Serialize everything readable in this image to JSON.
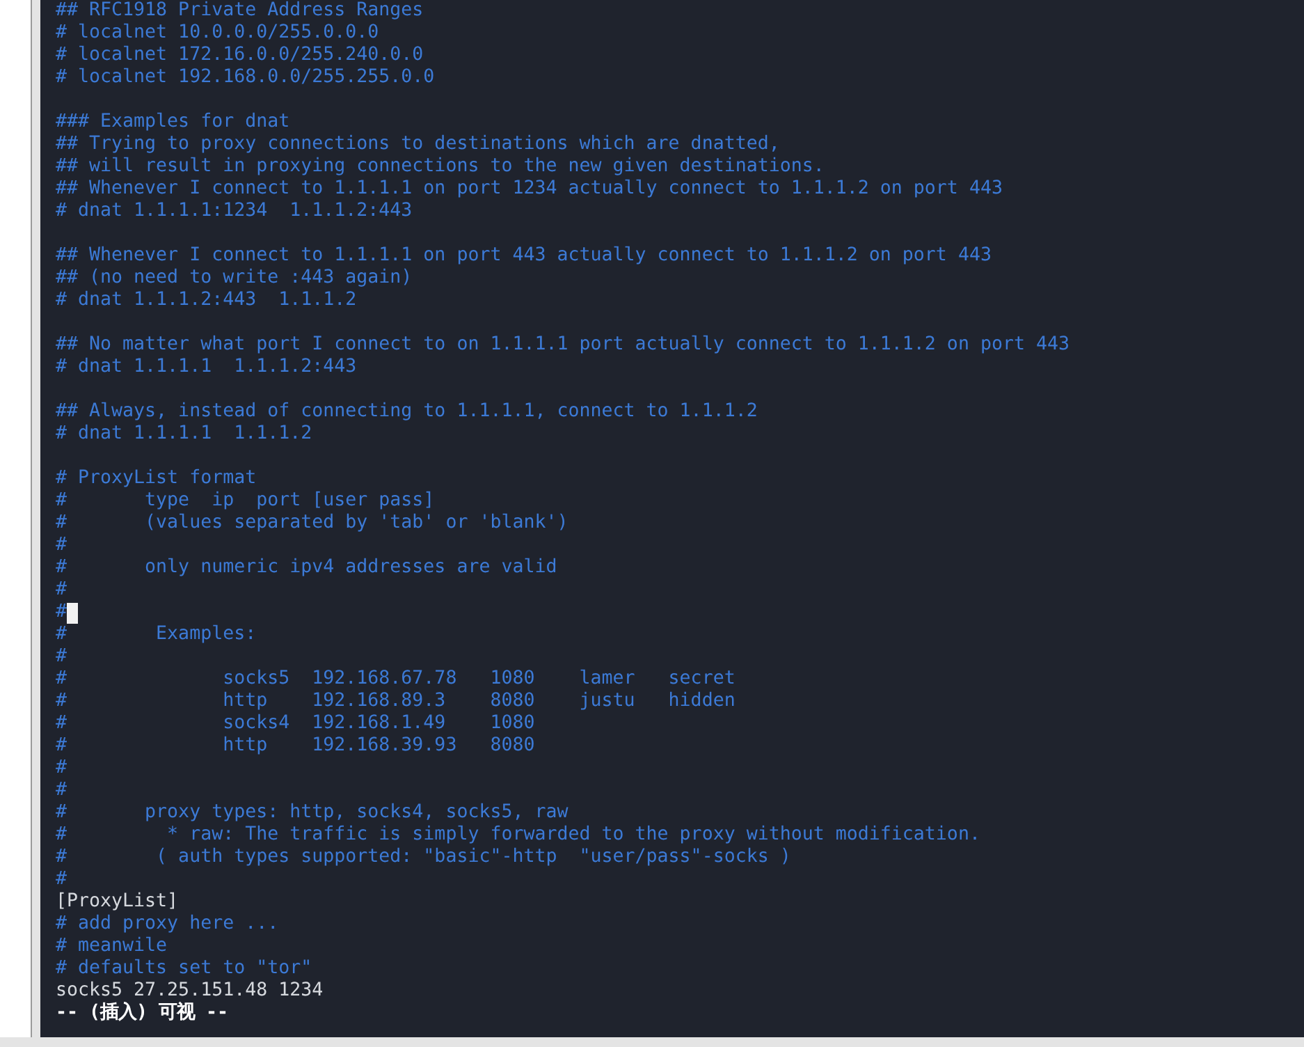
{
  "editor": {
    "lines": [
      {
        "kind": "comment",
        "text": "## RFC1918 Private Address Ranges",
        "cursor": false
      },
      {
        "kind": "comment",
        "text": "# localnet 10.0.0.0/255.0.0.0",
        "cursor": false
      },
      {
        "kind": "comment",
        "text": "# localnet 172.16.0.0/255.240.0.0",
        "cursor": false
      },
      {
        "kind": "comment",
        "text": "# localnet 192.168.0.0/255.255.0.0",
        "cursor": false
      },
      {
        "kind": "blank",
        "cursor": false
      },
      {
        "kind": "comment",
        "text": "### Examples for dnat",
        "cursor": false
      },
      {
        "kind": "comment",
        "text": "## Trying to proxy connections to destinations which are dnatted,",
        "cursor": false
      },
      {
        "kind": "comment",
        "text": "## will result in proxying connections to the new given destinations.",
        "cursor": false
      },
      {
        "kind": "comment",
        "text": "## Whenever I connect to 1.1.1.1 on port 1234 actually connect to 1.1.1.2 on port 443",
        "cursor": false
      },
      {
        "kind": "comment",
        "text": "# dnat 1.1.1.1:1234  1.1.1.2:443",
        "cursor": false
      },
      {
        "kind": "blank",
        "cursor": false
      },
      {
        "kind": "comment",
        "text": "## Whenever I connect to 1.1.1.1 on port 443 actually connect to 1.1.1.2 on port 443",
        "cursor": false
      },
      {
        "kind": "comment",
        "text": "## (no need to write :443 again)",
        "cursor": false
      },
      {
        "kind": "comment",
        "text": "# dnat 1.1.1.2:443  1.1.1.2",
        "cursor": false
      },
      {
        "kind": "blank",
        "cursor": false
      },
      {
        "kind": "comment",
        "text": "## No matter what port I connect to on 1.1.1.1 port actually connect to 1.1.1.2 on port 443",
        "cursor": false
      },
      {
        "kind": "comment",
        "text": "# dnat 1.1.1.1  1.1.1.2:443",
        "cursor": false
      },
      {
        "kind": "blank",
        "cursor": false
      },
      {
        "kind": "comment",
        "text": "## Always, instead of connecting to 1.1.1.1, connect to 1.1.1.2",
        "cursor": false
      },
      {
        "kind": "comment",
        "text": "# dnat 1.1.1.1  1.1.1.2",
        "cursor": false
      },
      {
        "kind": "blank",
        "cursor": false
      },
      {
        "kind": "comment",
        "text": "# ProxyList format",
        "cursor": false
      },
      {
        "kind": "comment",
        "text": "#       type  ip  port [user pass]",
        "cursor": false
      },
      {
        "kind": "comment",
        "text": "#       (values separated by 'tab' or 'blank')",
        "cursor": false
      },
      {
        "kind": "comment",
        "text": "#",
        "cursor": false
      },
      {
        "kind": "comment",
        "text": "#       only numeric ipv4 addresses are valid",
        "cursor": false
      },
      {
        "kind": "comment",
        "text": "#",
        "cursor": false
      },
      {
        "kind": "comment",
        "text": "#",
        "cursor": true
      },
      {
        "kind": "comment",
        "text": "#        Examples:",
        "cursor": false
      },
      {
        "kind": "comment",
        "text": "#",
        "cursor": false
      },
      {
        "kind": "comment",
        "text": "#              socks5  192.168.67.78   1080    lamer   secret",
        "cursor": false
      },
      {
        "kind": "comment",
        "text": "#              http    192.168.89.3    8080    justu   hidden",
        "cursor": false
      },
      {
        "kind": "comment",
        "text": "#              socks4  192.168.1.49    1080",
        "cursor": false
      },
      {
        "kind": "comment",
        "text": "#              http    192.168.39.93   8080",
        "cursor": false
      },
      {
        "kind": "comment",
        "text": "#",
        "cursor": false
      },
      {
        "kind": "comment",
        "text": "#",
        "cursor": false
      },
      {
        "kind": "comment",
        "text": "#       proxy types: http, socks4, socks5, raw",
        "cursor": false
      },
      {
        "kind": "comment",
        "text": "#         * raw: The traffic is simply forwarded to the proxy without modification.",
        "cursor": false
      },
      {
        "kind": "comment",
        "text": "#        ( auth types supported: \"basic\"-http  \"user/pass\"-socks )",
        "cursor": false
      },
      {
        "kind": "comment",
        "text": "#",
        "cursor": false
      },
      {
        "kind": "plain",
        "text": "[ProxyList]",
        "cursor": false
      },
      {
        "kind": "comment",
        "text": "# add proxy here ...",
        "cursor": false
      },
      {
        "kind": "comment",
        "text": "# meanwile",
        "cursor": false
      },
      {
        "kind": "comment",
        "text": "# defaults set to \"tor\"",
        "cursor": false
      },
      {
        "kind": "plain",
        "text": "socks5 27.25.151.48 1234",
        "cursor": false
      },
      {
        "kind": "mode",
        "text": "-- (插入) 可视 --",
        "cursor": false
      }
    ]
  }
}
